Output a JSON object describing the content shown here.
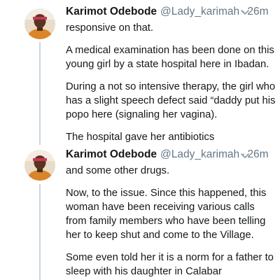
{
  "tweets": [
    {
      "display_name": "Karimot Odebode",
      "handle": "@Lady_karimah",
      "separator": "·",
      "time": "26m",
      "paragraphs": [
        "responsive on that.",
        "A medical examination has been done on this young girl by a state hospital here in Ibadan.",
        "During a not so intensive therapy, the girl who has a slight speech defect said “daddy put his popo here (signaling her vagina).",
        "The hospital gave her antibiotics"
      ]
    },
    {
      "display_name": "Karimot Odebode",
      "handle": "@Lady_karimah",
      "separator": "·",
      "time": "26m",
      "paragraphs": [
        "and some other drugs.",
        "Now, to the issue. Since this happened, this woman have been receiving various calls from family members who have been telling her to keep shut and come to the Village.",
        "Some even told her it is a norm for a father to sleep with his daughter in Calabar"
      ]
    }
  ],
  "icons": {
    "avatar": "profile-photo",
    "menu": "chevron-down-icon"
  },
  "colors": {
    "text": "#14171a",
    "secondary": "#657786",
    "thread_line": "#ccd6dd"
  }
}
